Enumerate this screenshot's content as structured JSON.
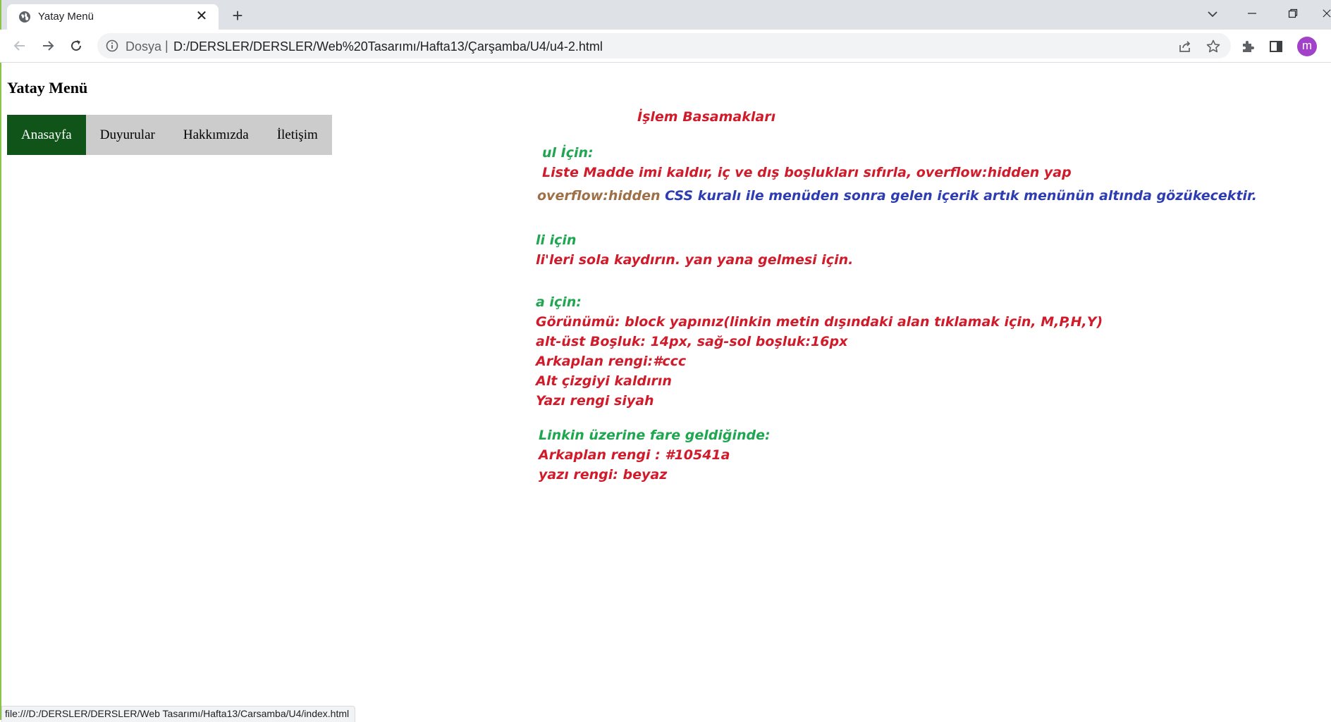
{
  "browser": {
    "tab_title": "Yatay Menü",
    "address_scheme": "Dosya",
    "address_separator": "|",
    "address_url": "D:/DERSLER/DERSLER/Web%20Tasarımı/Hafta13/Çarşamba/U4/u4-2.html",
    "profile_initial": "m",
    "status_url": "file:///D:/DERSLER/DERSLER/Web Tasarımı/Hafta13/Carsamba/U4/index.html",
    "icons": [
      "globe-icon",
      "close-icon",
      "plus-icon",
      "chevron-down-icon",
      "minimize-icon",
      "restore-icon",
      "back-arrow-icon",
      "forward-arrow-icon",
      "reload-icon",
      "info-icon",
      "share-icon",
      "star-icon",
      "puzzle-icon",
      "side-panel-icon"
    ]
  },
  "page": {
    "heading": "Yatay Menü",
    "menu": [
      {
        "label": "Anasayfa",
        "active": true
      },
      {
        "label": "Duyurular",
        "active": false
      },
      {
        "label": "Hakkımızda",
        "active": false
      },
      {
        "label": "İletişim",
        "active": false
      }
    ],
    "notes": {
      "steps_title": "İşlem Basamakları",
      "ul_heading": "ul İçin:",
      "ul_text": "Liste Madde imi kaldır, iç ve dış boşlukları sıfırla, overflow:hidden yap",
      "overflow_keyword": "overflow:hidden",
      "overflow_explanation": "CSS kuralı ile menüden sonra gelen içerik artık menünün altında gözükecektir.",
      "li_heading": "li için",
      "li_text": "li'leri sola kaydırın. yan yana gelmesi için.",
      "a_heading": "a için:",
      "a_line1": "Görünümü: block yapınız(linkin metin dışındaki alan tıklamak için, M,P,H,Y)",
      "a_line2": "alt-üst Boşluk: 14px, sağ-sol boşluk:16px",
      "a_line3": "Arkaplan rengi:#ccc",
      "a_line4": "Alt çizgiyi kaldırın",
      "a_line5": "Yazı rengi siyah",
      "hover_heading": "Linkin üzerine fare geldiğinde:",
      "hover_line1": "Arkaplan rengi : #10541a",
      "hover_line2": "yazı rengi: beyaz"
    },
    "colors": {
      "menu_background": "#cccccc",
      "menu_active_background": "#10541a",
      "note_red": "#d11a2a",
      "note_green": "#1fa650",
      "note_brown": "#9e7048",
      "note_blue": "#2e3cb2"
    }
  }
}
